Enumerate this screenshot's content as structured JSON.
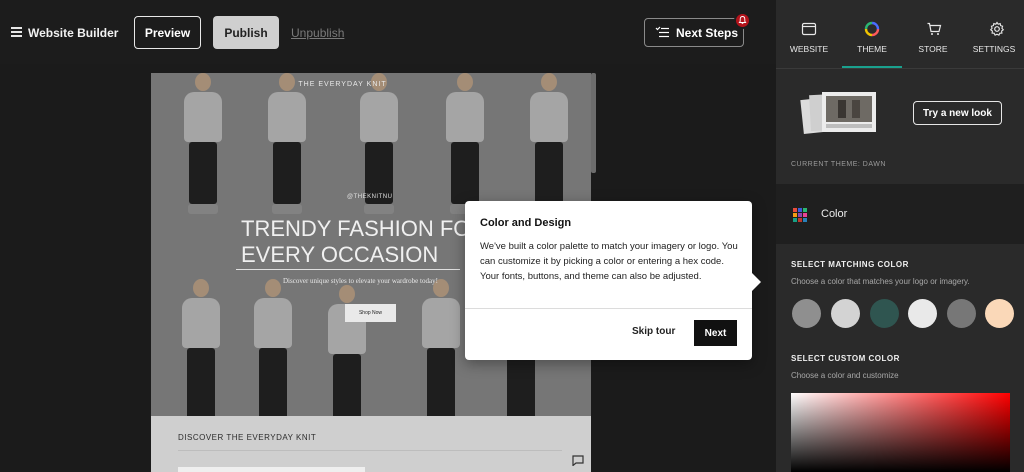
{
  "header": {
    "app_title": "Website Builder",
    "preview_label": "Preview",
    "publish_label": "Publish",
    "unpublish_label": "Unpublish",
    "next_steps_label": "Next Steps"
  },
  "site": {
    "brand": "THE EVERYDAY KNIT",
    "handle": "@THEKNITNU",
    "hero_title": "TRENDY FASHION FOR\nEVERY OCCASION",
    "hero_subtitle": "Discover unique styles to elevate your wardrobe today!",
    "shop_button": "Shop Now",
    "discover_title": "DISCOVER THE EVERYDAY KNIT"
  },
  "tour": {
    "title": "Color and Design",
    "body": "We've built a color palette to match your imagery or logo. You can customize it by picking a color or entering a hex code. Your fonts, buttons, and theme can also be adjusted.",
    "skip_label": "Skip tour",
    "next_label": "Next"
  },
  "panel": {
    "tabs": [
      {
        "label": "WEBSITE",
        "icon": "browser-window-icon"
      },
      {
        "label": "THEME",
        "icon": "color-wheel-icon",
        "active": true
      },
      {
        "label": "STORE",
        "icon": "shopping-cart-icon"
      },
      {
        "label": "SETTINGS",
        "icon": "gear-icon"
      }
    ],
    "try_new_look": "Try a new look",
    "current_theme": "CURRENT THEME: DAWN",
    "color_section_label": "Color",
    "matching_title": "SELECT MATCHING COLOR",
    "matching_sub": "Choose a color that matches your logo or imagery.",
    "custom_title": "SELECT CUSTOM COLOR",
    "custom_sub": "Choose a color and customize",
    "swatches": [
      "#8f8f8f",
      "#d3d3d3",
      "#2f5550",
      "#e9e9e9",
      "#777777",
      "#fad8b8"
    ]
  },
  "colors": {
    "accent_tab_underline": "#1aa18e",
    "notification_badge": "#b3131b"
  }
}
